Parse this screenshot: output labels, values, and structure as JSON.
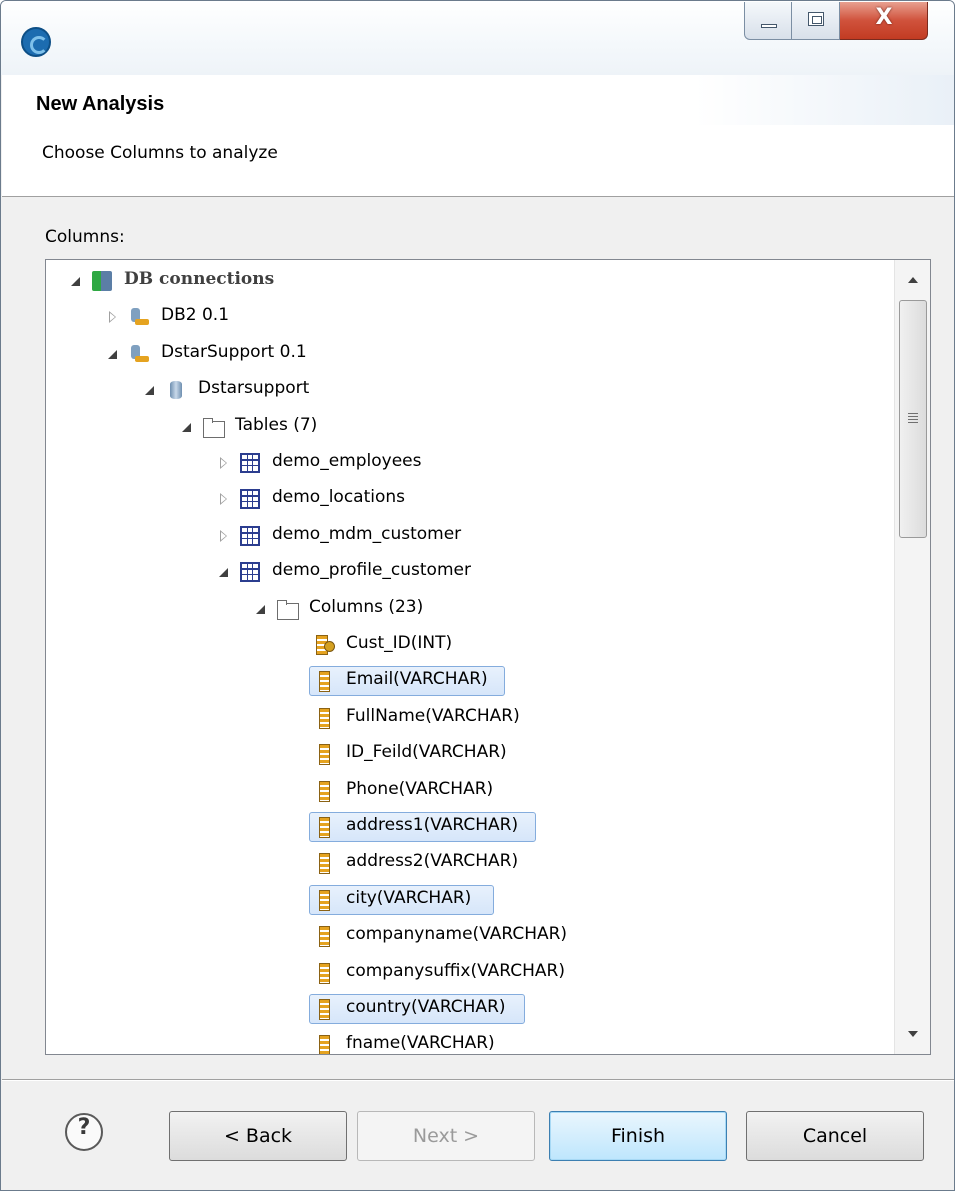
{
  "window": {
    "app_icon": "talend-studio-icon",
    "buttons": [
      "minimize",
      "maximize",
      "close"
    ],
    "close_glyph": "X"
  },
  "header": {
    "title": "New Analysis",
    "description": "Choose Columns to analyze"
  },
  "columns_label": "Columns:",
  "tree": [
    {
      "label": "DB connections",
      "expander": "open",
      "icon": "db-connections-icon",
      "level": 0,
      "selected": false,
      "bold": true
    },
    {
      "label": "DB2 0.1",
      "expander": "closed",
      "icon": "db-connection-icon",
      "level": 1,
      "selected": false
    },
    {
      "label": "DstarSupport 0.1",
      "expander": "open",
      "icon": "db-connection-icon",
      "level": 1,
      "selected": false
    },
    {
      "label": "Dstarsupport",
      "expander": "open",
      "icon": "database-icon",
      "level": 2,
      "selected": false
    },
    {
      "label": "Tables (7)",
      "expander": "open",
      "icon": "folder-icon",
      "level": 3,
      "selected": false
    },
    {
      "label": "demo_employees",
      "expander": "closed",
      "icon": "table-icon",
      "level": 4,
      "selected": false
    },
    {
      "label": "demo_locations",
      "expander": "closed",
      "icon": "table-icon",
      "level": 4,
      "selected": false
    },
    {
      "label": "demo_mdm_customer",
      "expander": "closed",
      "icon": "table-icon",
      "level": 4,
      "selected": false
    },
    {
      "label": "demo_profile_customer",
      "expander": "open",
      "icon": "table-icon",
      "level": 4,
      "selected": false
    },
    {
      "label": "Columns (23)",
      "expander": "open",
      "icon": "folder-icon",
      "level": 5,
      "selected": false
    },
    {
      "label": "Cust_ID(INT)",
      "expander": "none",
      "icon": "primary-key-icon",
      "level": 6,
      "selected": false
    },
    {
      "label": "Email(VARCHAR)",
      "expander": "none",
      "icon": "column-icon",
      "level": 6,
      "selected": true
    },
    {
      "label": "FullName(VARCHAR)",
      "expander": "none",
      "icon": "column-icon",
      "level": 6,
      "selected": false
    },
    {
      "label": "ID_Feild(VARCHAR)",
      "expander": "none",
      "icon": "column-icon",
      "level": 6,
      "selected": false
    },
    {
      "label": "Phone(VARCHAR)",
      "expander": "none",
      "icon": "column-icon",
      "level": 6,
      "selected": false
    },
    {
      "label": "address1(VARCHAR)",
      "expander": "none",
      "icon": "column-icon",
      "level": 6,
      "selected": true
    },
    {
      "label": "address2(VARCHAR)",
      "expander": "none",
      "icon": "column-icon",
      "level": 6,
      "selected": false
    },
    {
      "label": "city(VARCHAR)",
      "expander": "none",
      "icon": "column-icon",
      "level": 6,
      "selected": true
    },
    {
      "label": "companyname(VARCHAR)",
      "expander": "none",
      "icon": "column-icon",
      "level": 6,
      "selected": false
    },
    {
      "label": "companysuffix(VARCHAR)",
      "expander": "none",
      "icon": "column-icon",
      "level": 6,
      "selected": false
    },
    {
      "label": "country(VARCHAR)",
      "expander": "none",
      "icon": "column-icon",
      "level": 6,
      "selected": true
    },
    {
      "label": "fname(VARCHAR)",
      "expander": "none",
      "icon": "column-icon",
      "level": 6,
      "selected": false
    }
  ],
  "footer": {
    "help_glyph": "?",
    "back_label": "< Back",
    "next_label": "Next >",
    "finish_label": "Finish",
    "cancel_label": "Cancel",
    "next_enabled": false
  },
  "colors": {
    "selection_border": "#84acdd",
    "selection_fill": "#dce9fb",
    "finish_border": "#3c7fb1"
  }
}
